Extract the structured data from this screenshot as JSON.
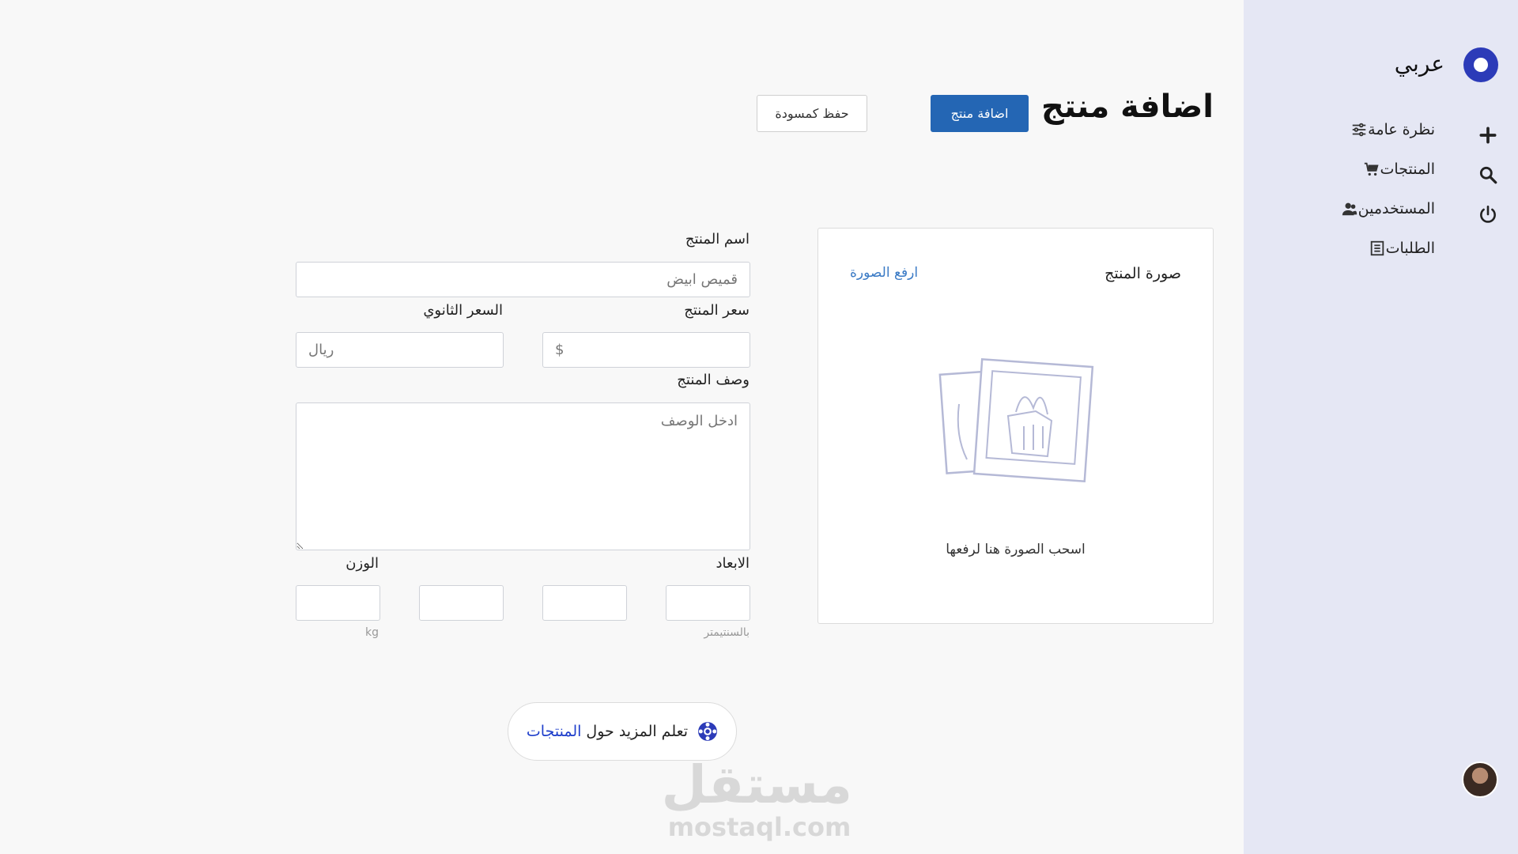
{
  "brand": {
    "name": "عربي"
  },
  "sidebar": {
    "items": [
      {
        "label": "نظرة عامة",
        "icon": "sliders-icon"
      },
      {
        "label": "المنتجات",
        "icon": "cart-icon"
      },
      {
        "label": "المستخدمين",
        "icon": "users-icon"
      },
      {
        "label": "الطلبات",
        "icon": "orders-icon"
      }
    ],
    "quick_actions": [
      "plus-icon",
      "search-icon",
      "power-icon"
    ]
  },
  "header": {
    "title": "اضافة منتج",
    "primary_button": "اضافة منتج",
    "secondary_button": "حفظ كمسودة"
  },
  "image_card": {
    "title": "صورة المنتج",
    "upload_link": "ارفع الصورة",
    "drop_text": "اسحب الصورة هنا لرفعها"
  },
  "form": {
    "name_label": "اسم المنتج",
    "name_placeholder": "قميص ابيض",
    "price_label": "سعر المنتج",
    "price_placeholder": "$",
    "secondary_price_label": "السعر الثانوي",
    "secondary_price_placeholder": "ريال",
    "description_label": "وصف المنتج",
    "description_placeholder": "ادخل الوصف",
    "dimensions_label": "الابعاد",
    "dimensions_hint": "بالسنتيمتر",
    "weight_label": "الوزن",
    "weight_hint": "kg"
  },
  "learn_more": {
    "prefix": "تعلم المزيد حول ",
    "link": "المنتجات"
  },
  "watermark": {
    "ar": "مستقل",
    "en": "mostaql.com"
  },
  "colors": {
    "accent": "#2466b4",
    "brand": "#2c3bb8",
    "sidebar_bg": "#e5e7f4",
    "link": "#1e3ecb"
  }
}
